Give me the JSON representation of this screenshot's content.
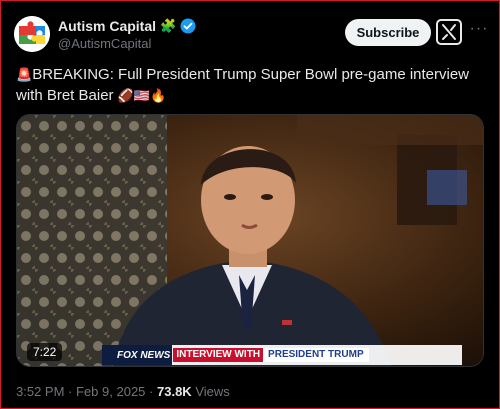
{
  "author": {
    "display_name": "Autism Capital",
    "handle": "@AutismCapital",
    "name_emoji": "🧩",
    "verified": true,
    "verified_color": "#1d9bf0"
  },
  "actions": {
    "subscribe_label": "Subscribe",
    "grok_icon": "grok-icon",
    "more_icon": "more-icon"
  },
  "tweet": {
    "alert_emoji": "🚨",
    "text": "BREAKING: Full President Trump Super Bowl pre-game interview with Bret Baier",
    "trailing_emojis": "🏈🇺🇸🔥"
  },
  "video": {
    "duration": "7:22",
    "chyron_brand": "FOX NEWS",
    "chyron_label": "INTERVIEW WITH",
    "chyron_subject": "PRESIDENT TRUMP"
  },
  "meta": {
    "time": "3:52 PM",
    "date": "Feb 9, 2025",
    "separator": "·",
    "views_count": "73.8K",
    "views_label": "Views"
  },
  "colors": {
    "background": "#000000",
    "text_primary": "#e7e9ea",
    "text_secondary": "#71767b",
    "subscribe_bg": "#eff3f4",
    "border": "#d11b2a"
  }
}
